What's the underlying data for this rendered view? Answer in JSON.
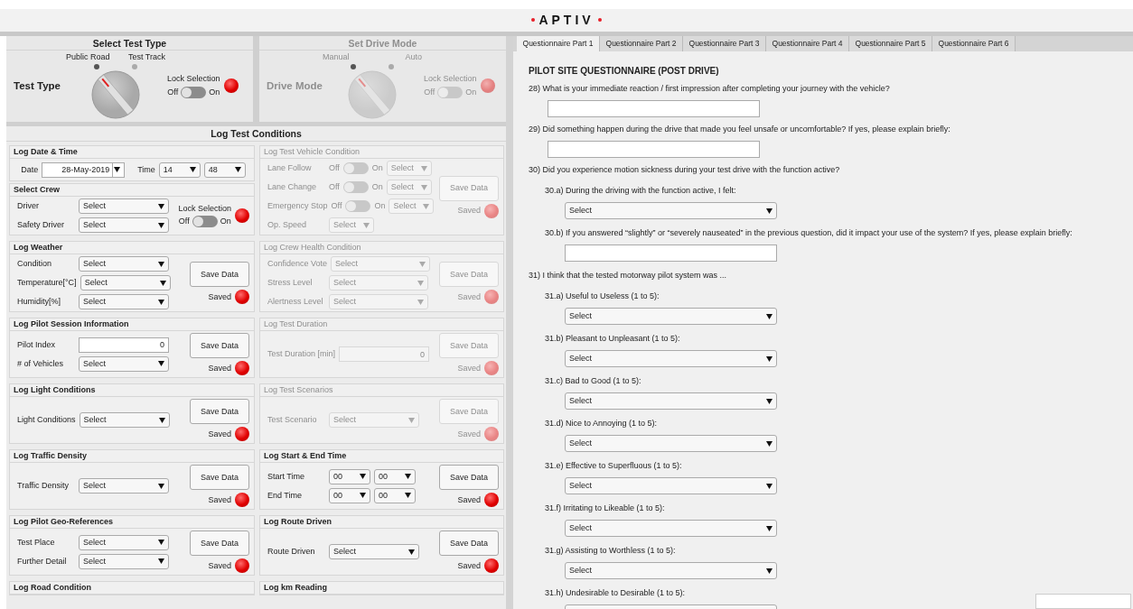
{
  "header": {
    "logo": "APTIV"
  },
  "mode_panels": [
    {
      "title": "Select Test Type",
      "label": "Test Type",
      "disabled": false,
      "options": [
        {
          "label": "Public Road",
          "selected": true
        },
        {
          "label": "Test Track",
          "selected": false
        }
      ],
      "lock": {
        "label": "Lock Selection",
        "off_label": "Off",
        "on_label": "On",
        "on": false,
        "saved": false
      }
    },
    {
      "title": "Set Drive Mode",
      "label": "Drive Mode",
      "disabled": true,
      "options": [
        {
          "label": "Manual",
          "selected": true
        },
        {
          "label": "Auto",
          "selected": false
        }
      ],
      "lock": {
        "label": "Lock Selection",
        "off_label": "Off",
        "on_label": "On",
        "on": false,
        "saved": false
      }
    }
  ],
  "conditions": {
    "title": "Log Test Conditions",
    "rows": [
      {
        "left": [
          {
            "title": "Log Date & Time",
            "disabled": false,
            "inline": true,
            "fields": [
              {
                "kind": "date",
                "label": "Date",
                "value": "28-May-2019"
              },
              {
                "kind": "time",
                "label": "Time",
                "values": [
                  "14",
                  "48"
                ]
              }
            ]
          },
          {
            "title": "Select Crew",
            "disabled": false,
            "fields": [
              {
                "kind": "select",
                "label": "Driver",
                "value": "Select"
              },
              {
                "kind": "select",
                "label": "Safety Driver",
                "value": "Select"
              }
            ],
            "lock": {
              "label": "Lock Selection",
              "off_label": "Off",
              "on_label": "On",
              "on": false,
              "saved": false
            }
          }
        ],
        "right": [
          {
            "title": "Log Test Vehicle Condition",
            "disabled": true,
            "fields": [
              {
                "kind": "toggle_select",
                "label": "Lane Follow",
                "off_label": "Off",
                "on_label": "On",
                "on": false,
                "value": "Select"
              },
              {
                "kind": "toggle_select",
                "label": "Lane Change",
                "off_label": "Off",
                "on_label": "On",
                "on": false,
                "value": "Select"
              },
              {
                "kind": "toggle_select",
                "label": "Emergency Stop",
                "off_label": "Off",
                "on_label": "On",
                "on": false,
                "value": "Select"
              },
              {
                "kind": "small_select",
                "label": "Op. Speed",
                "value": "Select"
              }
            ],
            "save": {
              "label": "Save Data",
              "status": "Saved",
              "saved": false
            }
          }
        ]
      },
      {
        "left": [
          {
            "title": "Log Weather",
            "disabled": false,
            "fields": [
              {
                "kind": "select",
                "label": "Condition",
                "value": "Select"
              },
              {
                "kind": "select",
                "label": "Temperature[°C]",
                "value": "Select"
              },
              {
                "kind": "select",
                "label": "Humidity[%]",
                "value": "Select"
              }
            ],
            "save": {
              "label": "Save Data",
              "status": "Saved",
              "saved": false
            }
          }
        ],
        "right": [
          {
            "title": "Log Crew Health Condition",
            "disabled": true,
            "fields": [
              {
                "kind": "wide_select",
                "label": "Confidence Vote",
                "value": "Select"
              },
              {
                "kind": "wide_select",
                "label": "Stress Level",
                "value": "Select"
              },
              {
                "kind": "wide_select",
                "label": "Alertness Level",
                "value": "Select"
              }
            ],
            "save": {
              "label": "Save Data",
              "status": "Saved",
              "saved": false
            }
          }
        ]
      },
      {
        "left": [
          {
            "title": "Log Pilot Session Information",
            "disabled": false,
            "fields": [
              {
                "kind": "text",
                "label": "Pilot Index",
                "value": "0"
              },
              {
                "kind": "select",
                "label": "# of Vehicles",
                "value": "Select"
              }
            ],
            "save": {
              "label": "Save Data",
              "status": "Saved",
              "saved": false
            }
          }
        ],
        "right": [
          {
            "title": "Log Test Duration",
            "disabled": true,
            "fields": [
              {
                "kind": "text",
                "label": "Test Duration [min]",
                "value": "0"
              }
            ],
            "save": {
              "label": "Save Data",
              "status": "Saved",
              "saved": false
            }
          }
        ]
      },
      {
        "left": [
          {
            "title": "Log Light Conditions",
            "disabled": false,
            "fields": [
              {
                "kind": "select",
                "label": "Light Conditions",
                "value": "Select"
              }
            ],
            "save": {
              "label": "Save Data",
              "status": "Saved",
              "saved": false
            }
          }
        ],
        "right": [
          {
            "title": "Log Test Scenarios",
            "disabled": true,
            "fields": [
              {
                "kind": "select",
                "label": "Test Scenario",
                "value": "Select"
              }
            ],
            "save": {
              "label": "Save Data",
              "status": "Saved",
              "saved": false
            }
          }
        ]
      },
      {
        "left": [
          {
            "title": "Log Traffic Density",
            "disabled": false,
            "fields": [
              {
                "kind": "select",
                "label": "Traffic Density",
                "value": "Select"
              }
            ],
            "save": {
              "label": "Save Data",
              "status": "Saved",
              "saved": false
            }
          }
        ],
        "right": [
          {
            "title": "Log Start & End Time",
            "disabled": false,
            "fields": [
              {
                "kind": "time",
                "label": "Start Time",
                "values": [
                  "00",
                  "00"
                ]
              },
              {
                "kind": "time",
                "label": "End Time",
                "values": [
                  "00",
                  "00"
                ]
              }
            ],
            "save": {
              "label": "Save Data",
              "status": "Saved",
              "saved": false
            }
          }
        ]
      },
      {
        "left": [
          {
            "title": "Log Pilot Geo-References",
            "disabled": false,
            "fields": [
              {
                "kind": "select",
                "label": "Test Place",
                "value": "Select"
              },
              {
                "kind": "select",
                "label": "Further Detail",
                "value": "Select"
              }
            ],
            "save": {
              "label": "Save Data",
              "status": "Saved",
              "saved": false
            }
          }
        ],
        "right": [
          {
            "title": "Log Route Driven",
            "disabled": false,
            "fields": [
              {
                "kind": "select",
                "label": "Route Driven",
                "value": "Select"
              }
            ],
            "save": {
              "label": "Save Data",
              "status": "Saved",
              "saved": false
            }
          }
        ]
      },
      {
        "left": [
          {
            "title": "Log Road Condition",
            "disabled": false
          }
        ],
        "right": [
          {
            "title": "Log km Reading",
            "disabled": false
          }
        ]
      }
    ]
  },
  "questionnaire": {
    "tabs": [
      {
        "label": "Questionnaire Part 1",
        "selected": true
      },
      {
        "label": "Questionnaire Part 2",
        "selected": false
      },
      {
        "label": "Questionnaire Part 3",
        "selected": false
      },
      {
        "label": "Questionnaire Part 4",
        "selected": false
      },
      {
        "label": "Questionnaire Part 5",
        "selected": false
      },
      {
        "label": "Questionnaire Part 6",
        "selected": false
      }
    ],
    "heading": "PILOT SITE QUESTIONNAIRE (POST DRIVE)",
    "questions": [
      {
        "text": "28) What is your immediate reaction / first impression after completing your journey with the vehicle?",
        "answer": {
          "kind": "text"
        }
      },
      {
        "text": "29) Did something happen during the drive that made you feel unsafe or uncomfortable? If yes, please explain briefly:",
        "answer": {
          "kind": "text"
        }
      },
      {
        "text": "30) Did you experience motion sickness during your test drive with the function active?",
        "children": [
          {
            "text": "30.a) During the driving with the function active, I felt:",
            "answer": {
              "kind": "select",
              "value": "Select"
            }
          },
          {
            "text": "30.b) If you answered “slightly” or “severely nauseated” in the previous question, did it impact your use of the system? If yes, please explain briefly:",
            "answer": {
              "kind": "text"
            }
          }
        ]
      },
      {
        "text": "31) I think that the tested motorway pilot system was ...",
        "children": [
          {
            "text": "31.a) Useful to Useless (1 to 5):",
            "answer": {
              "kind": "select",
              "value": "Select"
            }
          },
          {
            "text": "31.b) Pleasant to Unpleasant (1 to 5):",
            "answer": {
              "kind": "select",
              "value": "Select"
            }
          },
          {
            "text": "31.c) Bad to Good (1 to 5):",
            "answer": {
              "kind": "select",
              "value": "Select"
            }
          },
          {
            "text": "31.d) Nice to Annoying (1 to 5):",
            "answer": {
              "kind": "select",
              "value": "Select"
            }
          },
          {
            "text": "31.e) Effective to Superfluous (1 to 5):",
            "answer": {
              "kind": "select",
              "value": "Select"
            }
          },
          {
            "text": "31.f) Irritating to Likeable (1 to 5):",
            "answer": {
              "kind": "select",
              "value": "Select"
            }
          },
          {
            "text": "31.g) Assisting to Worthless (1 to 5):",
            "answer": {
              "kind": "select",
              "value": "Select"
            }
          },
          {
            "text": "31.h) Undesirable to Desirable (1 to 5):",
            "answer": {
              "kind": "select"
            }
          }
        ]
      }
    ]
  }
}
